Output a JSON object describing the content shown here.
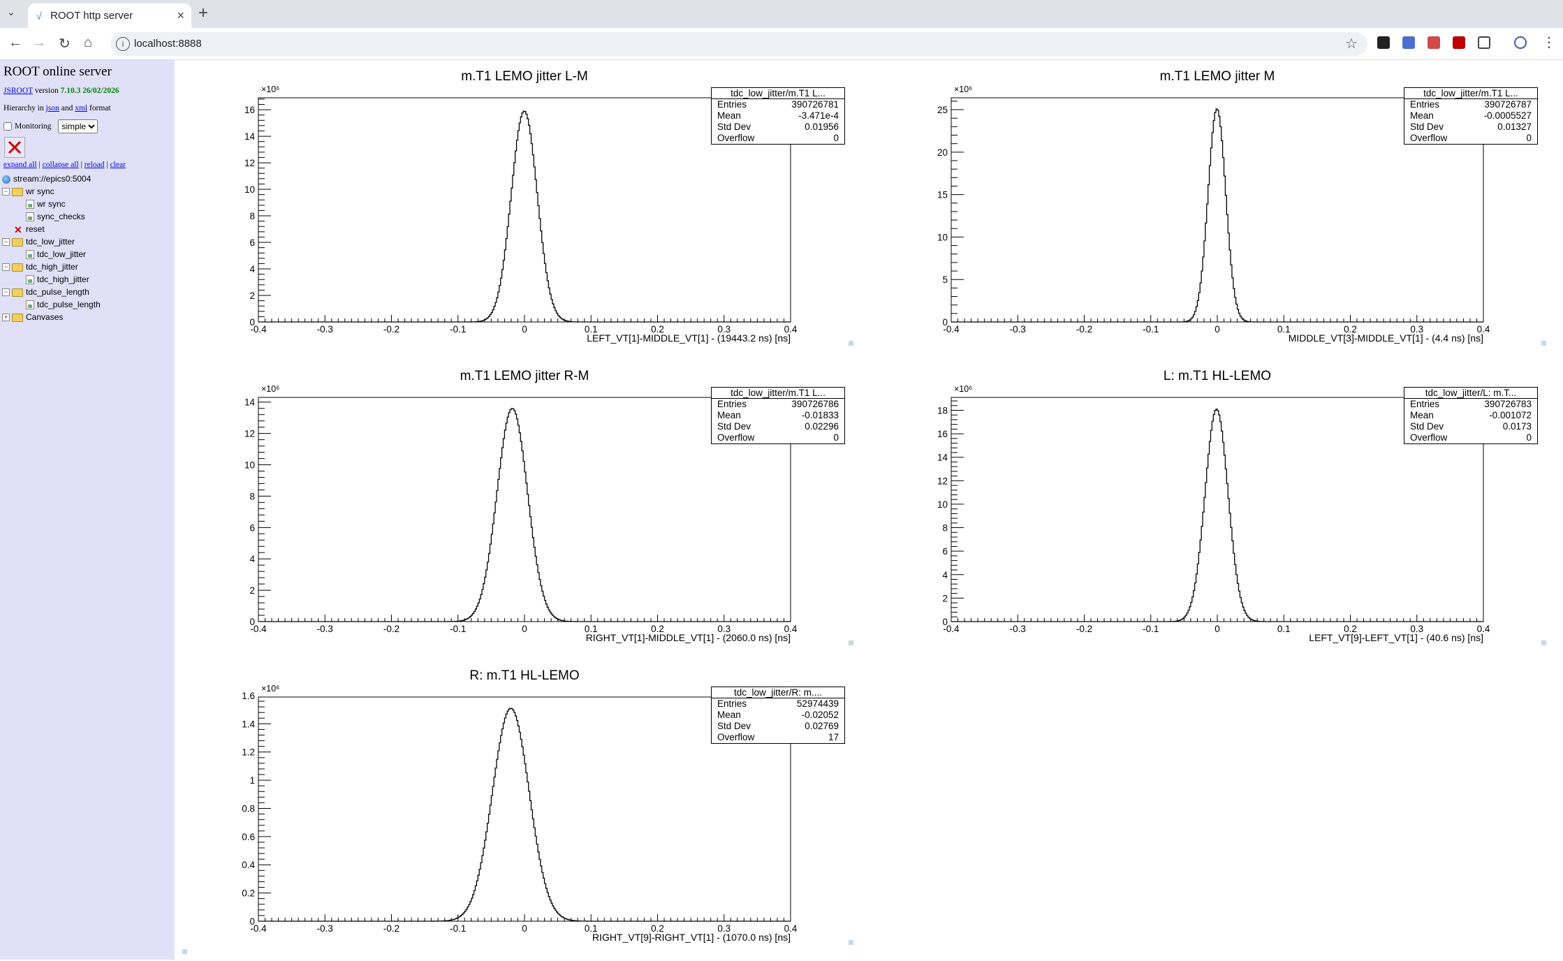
{
  "browser": {
    "tab_title": "ROOT http server",
    "url": "localhost:8888"
  },
  "sidebar": {
    "title": "ROOT online server",
    "version_link": "JSROOT",
    "version_word": "version",
    "version_value": "7.10.3 26/02/2026",
    "hier_prefix": "Hierarchy in",
    "hier_json": "json",
    "hier_and": "and",
    "hier_xml": "xml",
    "hier_suffix": "format",
    "monitoring_label": "Monitoring",
    "monitoring_mode": "simple",
    "links": [
      "expand all",
      "collapse all",
      "reload",
      "clear"
    ],
    "tree": [
      {
        "label": "stream://epics0:5004",
        "type": "root",
        "indent": 0
      },
      {
        "label": "wr sync",
        "type": "folder",
        "indent": 1,
        "pm": "−"
      },
      {
        "label": "wr sync",
        "type": "hist",
        "indent": 2
      },
      {
        "label": "sync_checks",
        "type": "hist",
        "indent": 2
      },
      {
        "label": "reset",
        "type": "cmd",
        "indent": 1
      },
      {
        "label": "tdc_low_jitter",
        "type": "folder",
        "indent": 1,
        "pm": "−"
      },
      {
        "label": "tdc_low_jitter",
        "type": "hist",
        "indent": 2
      },
      {
        "label": "tdc_high_jitter",
        "type": "folder",
        "indent": 1,
        "pm": "−"
      },
      {
        "label": "tdc_high_jitter",
        "type": "hist",
        "indent": 2
      },
      {
        "label": "tdc_pulse_length",
        "type": "folder",
        "indent": 1,
        "pm": "−"
      },
      {
        "label": "tdc_pulse_length",
        "type": "hist",
        "indent": 2
      },
      {
        "label": "Canvases",
        "type": "folder",
        "indent": 1,
        "pm": "+"
      }
    ]
  },
  "chart_data": [
    {
      "type": "histogram",
      "title": "m.T1 LEMO jitter L-M",
      "xlabel": "LEFT_VT[1]-MIDDLE_VT[1] - (19443.2 ns) [ns]",
      "xlim": [
        -0.4,
        0.4
      ],
      "ylim": [
        0,
        16.9
      ],
      "y_multiplier": "×10⁶",
      "yticks": [
        0,
        2,
        4,
        6,
        8,
        10,
        12,
        14,
        16
      ],
      "peak": 15.9,
      "mean": -0.000347,
      "stddev": 0.01956,
      "stats": {
        "name": "tdc_low_jitter/m.T1 L...",
        "Entries": "390726781",
        "Mean": "-3.471e-4",
        "Std Dev": "0.01956",
        "Overflow": "0"
      }
    },
    {
      "type": "histogram",
      "title": "m.T1 LEMO jitter M",
      "xlabel": "MIDDLE_VT[3]-MIDDLE_VT[1] - (4.4 ns) [ns]",
      "xlim": [
        -0.4,
        0.4
      ],
      "ylim": [
        0,
        26.4
      ],
      "y_multiplier": "×10⁶",
      "yticks": [
        0,
        5,
        10,
        15,
        20,
        25
      ],
      "peak": 25.1,
      "mean": -0.0005527,
      "stddev": 0.01327,
      "stats": {
        "name": "tdc_low_jitter/m.T1 L...",
        "Entries": "390726787",
        "Mean": "-0.0005527",
        "Std Dev": "0.01327",
        "Overflow": "0"
      }
    },
    {
      "type": "histogram",
      "title": "m.T1 LEMO jitter R-M",
      "xlabel": "RIGHT_VT[1]-MIDDLE_VT[1] - (2060.0 ns) [ns]",
      "xlim": [
        -0.4,
        0.4
      ],
      "ylim": [
        0,
        14.3
      ],
      "y_multiplier": "×10⁶",
      "yticks": [
        0,
        2,
        4,
        6,
        8,
        10,
        12,
        14
      ],
      "peak": 13.6,
      "mean": -0.01833,
      "stddev": 0.02296,
      "stats": {
        "name": "tdc_low_jitter/m.T1 L...",
        "Entries": "390726786",
        "Mean": "-0.01833",
        "Std Dev": "0.02296",
        "Overflow": "0"
      }
    },
    {
      "type": "histogram",
      "title": "L: m.T1 HL-LEMO",
      "xlabel": "LEFT_VT[9]-LEFT_VT[1] - (40.6 ns) [ns]",
      "xlim": [
        -0.4,
        0.4
      ],
      "ylim": [
        0,
        19.1
      ],
      "y_multiplier": "×10⁶",
      "yticks": [
        0,
        2,
        4,
        6,
        8,
        10,
        12,
        14,
        16,
        18
      ],
      "peak": 18.1,
      "mean": -0.001072,
      "stddev": 0.0173,
      "stats": {
        "name": "tdc_low_jitter/L: m.T...",
        "Entries": "390726783",
        "Mean": "-0.001072",
        "Std Dev": "0.0173",
        "Overflow": "0"
      }
    },
    {
      "type": "histogram",
      "title": "R: m.T1 HL-LEMO",
      "xlabel": "RIGHT_VT[9]-RIGHT_VT[1] - (1070.0 ns) [ns]",
      "xlim": [
        -0.4,
        0.4
      ],
      "ylim": [
        0,
        1.59
      ],
      "y_multiplier": "×10⁶",
      "yticks": [
        0,
        0.2,
        0.4,
        0.6,
        0.8,
        1,
        1.2,
        1.4,
        1.6
      ],
      "peak": 1.51,
      "mean": -0.02052,
      "stddev": 0.02769,
      "stats": {
        "name": "tdc_low_jitter/R: m....",
        "Entries": "52974439",
        "Mean": "-0.02052",
        "Std Dev": "0.02769",
        "Overflow": "17"
      }
    }
  ]
}
